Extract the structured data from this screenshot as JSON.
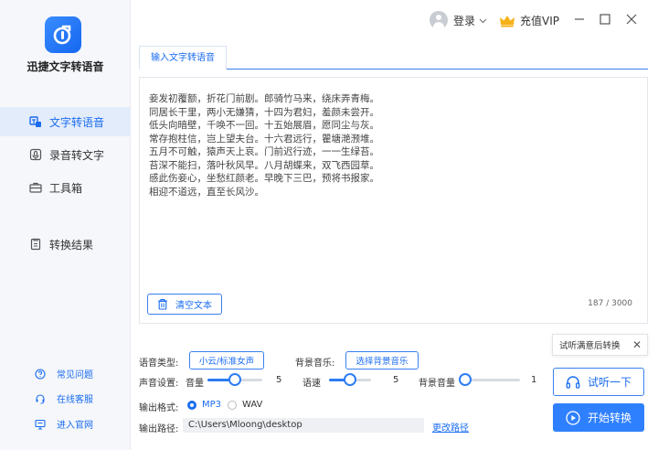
{
  "app": {
    "name": "迅捷文字转语音"
  },
  "sidebar": {
    "items": [
      {
        "label": "文字转语音",
        "active": true
      },
      {
        "label": "录音转文字",
        "active": false
      },
      {
        "label": "工具箱",
        "active": false
      },
      {
        "label": "转换结果",
        "active": false
      }
    ],
    "footer": [
      {
        "label": "常见问题"
      },
      {
        "label": "在线客服"
      },
      {
        "label": "进入官网"
      }
    ]
  },
  "header": {
    "login_label": "登录",
    "vip_label": "充值VIP"
  },
  "tabs": [
    {
      "label": "输入文字转语音"
    }
  ],
  "editor": {
    "text": "妾发初覆额，折花门前剧。郎骑竹马来，绕床弄青梅。\n同居长干里，两小无嫌猜，十四为君妇，羞颜未尝开。\n低头向暗壁，千唤不一回。十五始展眉，愿同尘与灰。\n常存抱柱信，岂上望夫台。十六君远行，瞿塘滟滪堆。\n五月不可触，猿声天上哀。门前迟行迹，一一生绿苔。\n苔深不能扫，落叶秋风早。八月胡蝶来，双飞西园草。\n感此伤妾心，坐愁红颜老。早晚下三巴，预将书报家。\n相迎不道远，直至长风沙。",
    "clear_label": "清空文本",
    "counter": "187 / 3000"
  },
  "settings": {
    "voice_type_label": "语音类型:",
    "voice_type_value": "小云/标准女声",
    "bg_music_label": "背景音乐:",
    "bg_music_value": "选择背景音乐",
    "sound_label": "声音设置:",
    "volume_label": "音量",
    "volume_value": "5",
    "volume_level": 0.5,
    "speed_label": "语速",
    "speed_value": "5",
    "speed_level": 0.5,
    "bg_volume_label": "背景音量",
    "bg_volume_value": "1",
    "bg_volume_level": 0.0,
    "format_label": "输出格式:",
    "format_options": [
      "MP3",
      "WAV"
    ],
    "format_selected": "MP3",
    "path_label": "输出路径:",
    "path_value": "C:\\Users\\Mloong\\desktop",
    "change_path_label": "更改路径"
  },
  "actions": {
    "tooltip": "试听满意后转换",
    "preview_label": "试听一下",
    "convert_label": "开始转换"
  },
  "colors": {
    "accent": "#1a6cf0",
    "button_primary": "#2f80ff"
  }
}
